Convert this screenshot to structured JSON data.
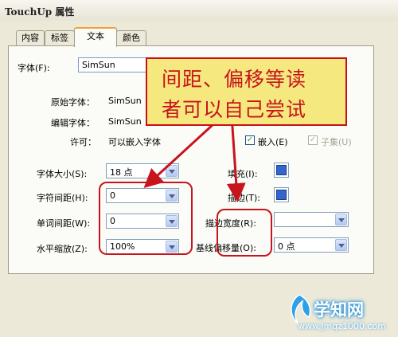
{
  "window": {
    "title": "TouchUp 属性"
  },
  "tabs": [
    {
      "label": "内容"
    },
    {
      "label": "标签"
    },
    {
      "label": "文本"
    },
    {
      "label": "颜色"
    }
  ],
  "font": {
    "label": "字体(F):",
    "value": "SimSun"
  },
  "original_font": {
    "label": "原始字体：",
    "value": "SimSun"
  },
  "edit_font": {
    "label": "编辑字体：",
    "value": "SimSun"
  },
  "permission": {
    "label": "许可：",
    "value": "可以嵌入字体"
  },
  "embed": {
    "label": "嵌入(E)",
    "checked": true
  },
  "subset": {
    "label": "子集(U)",
    "checked": true,
    "disabled": true
  },
  "font_size": {
    "label": "字体大小(S):",
    "value": "18 点"
  },
  "char_spacing": {
    "label": "字符间距(H):",
    "value": "0"
  },
  "word_spacing": {
    "label": "单词间距(W):",
    "value": "0"
  },
  "horiz_scale": {
    "label": "水平缩放(Z):",
    "value": "100%"
  },
  "fill": {
    "label": "填充(I):",
    "color": "#3366cc"
  },
  "stroke": {
    "label": "描边(T):",
    "color": "#3366cc"
  },
  "stroke_width": {
    "label": "描边宽度(R):",
    "value": ""
  },
  "baseline_offset": {
    "label": "基线偏移量(O):",
    "value": "0 点"
  },
  "annotation": {
    "line1": "间距、偏移等读",
    "line2": "者可以自己尝试"
  },
  "watermark": {
    "site": "学知网",
    "url": "www.jmqz1000.com"
  }
}
